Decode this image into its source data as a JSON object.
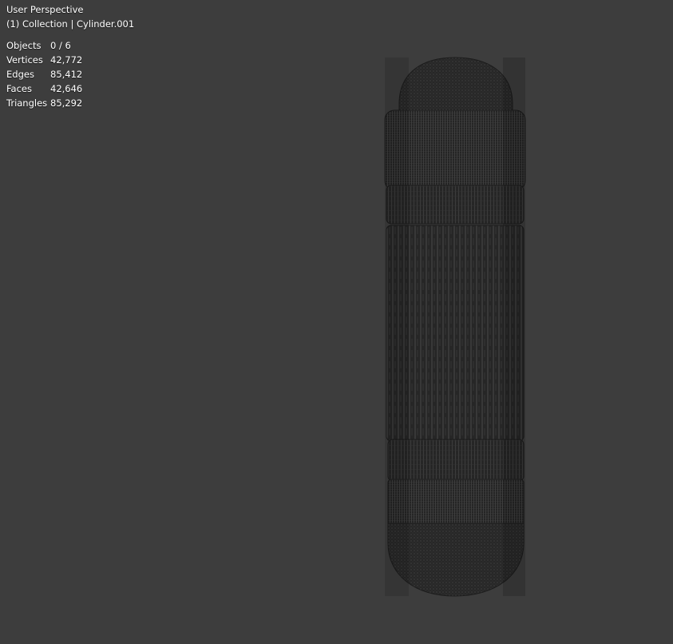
{
  "viewport": {
    "view_name": "User Perspective",
    "context": "(1) Collection | Cylinder.001"
  },
  "stats": [
    {
      "label": "Objects",
      "value": "0 / 6"
    },
    {
      "label": "Vertices",
      "value": "42,772"
    },
    {
      "label": "Edges",
      "value": "85,412"
    },
    {
      "label": "Faces",
      "value": "42,646"
    },
    {
      "label": "Triangles",
      "value": "85,292"
    }
  ],
  "colors": {
    "background": "#3d3d3d",
    "mesh_fill": "#2a2a2a",
    "wire": "#505050"
  }
}
